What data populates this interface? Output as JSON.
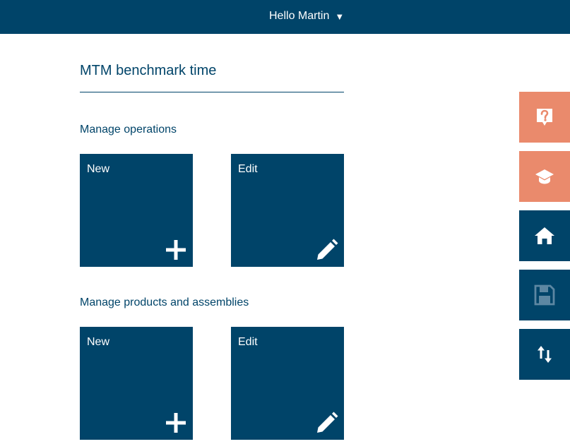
{
  "header": {
    "user_greeting": "Hello Martin",
    "caret": "▼"
  },
  "page": {
    "title": "MTM benchmark time"
  },
  "sections": [
    {
      "heading": "Manage operations",
      "tiles": [
        {
          "label": "New",
          "icon": "plus-icon"
        },
        {
          "label": "Edit",
          "icon": "pencil-icon"
        }
      ]
    },
    {
      "heading": "Manage products and assemblies",
      "tiles": [
        {
          "label": "New",
          "icon": "plus-icon"
        },
        {
          "label": "Edit",
          "icon": "pencil-icon"
        }
      ]
    }
  ],
  "side_toolbar": [
    {
      "icon": "help-icon",
      "color": "#ea8a6c"
    },
    {
      "icon": "graduation-cap-icon",
      "color": "#ea8a6c"
    },
    {
      "icon": "home-icon",
      "color": "#004469"
    },
    {
      "icon": "save-icon",
      "color": "#004469",
      "disabled": true
    },
    {
      "icon": "sort-arrows-icon",
      "color": "#004469"
    }
  ],
  "colors": {
    "primary": "#004469",
    "accent": "#ea8a6c",
    "background": "#ffffff"
  }
}
